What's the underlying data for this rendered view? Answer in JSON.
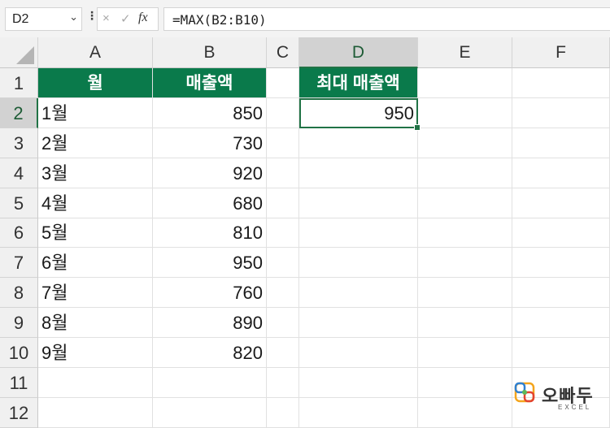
{
  "formula_bar": {
    "name_box": "D2",
    "formula": "=MAX(B2:B10)",
    "fx_label": "fx",
    "cancel_icon": "×",
    "enter_icon": "✓",
    "more_icon": "⋮",
    "dropdown_icon": "⌄"
  },
  "columns": [
    "A",
    "B",
    "C",
    "D",
    "E",
    "F"
  ],
  "rows": [
    "1",
    "2",
    "3",
    "4",
    "5",
    "6",
    "7",
    "8",
    "9",
    "10",
    "11",
    "12"
  ],
  "selected": {
    "column": "D",
    "row": "2"
  },
  "table": {
    "header_month": "월",
    "header_sales": "매출액",
    "months": [
      "1월",
      "2월",
      "3월",
      "4월",
      "5월",
      "6월",
      "7월",
      "8월",
      "9월"
    ],
    "sales": [
      "850",
      "730",
      "920",
      "680",
      "810",
      "950",
      "760",
      "890",
      "820"
    ]
  },
  "result": {
    "header": "최대 매출액",
    "value": "950"
  },
  "logo": {
    "brand": "오빠두",
    "sub": "EXCEL"
  },
  "colors": {
    "header_fill": "#0a7a4b",
    "selection": "#217346"
  }
}
